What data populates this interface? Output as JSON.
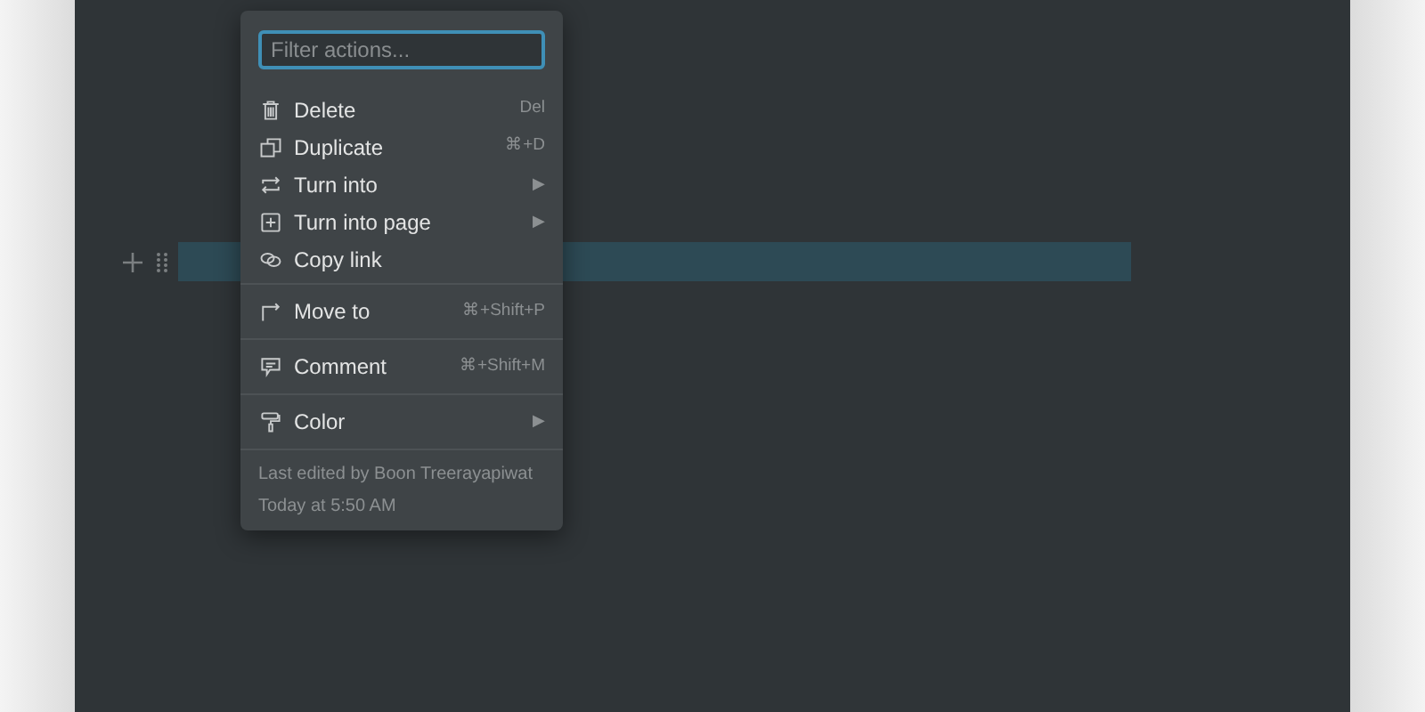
{
  "block": {
    "selected": true
  },
  "menu": {
    "filter": {
      "placeholder": "Filter actions..."
    },
    "sections": [
      {
        "items": [
          {
            "label": "Delete",
            "shortcut": "Del"
          },
          {
            "label": "Duplicate",
            "shortcut": "⌘+D"
          },
          {
            "label": "Turn into",
            "arrow": "▶"
          },
          {
            "label": "Turn into page",
            "arrow": "▶"
          },
          {
            "label": "Copy link"
          }
        ]
      },
      {
        "items": [
          {
            "label": "Move to",
            "shortcut": "⌘+Shift+P"
          }
        ]
      },
      {
        "items": [
          {
            "label": "Comment",
            "shortcut": "⌘+Shift+M"
          }
        ]
      },
      {
        "items": [
          {
            "label": "Color",
            "arrow": "▶"
          }
        ]
      }
    ],
    "footer": [
      "Last edited by Boon Treerayapiwat",
      "Today at 5:50 AM"
    ]
  }
}
